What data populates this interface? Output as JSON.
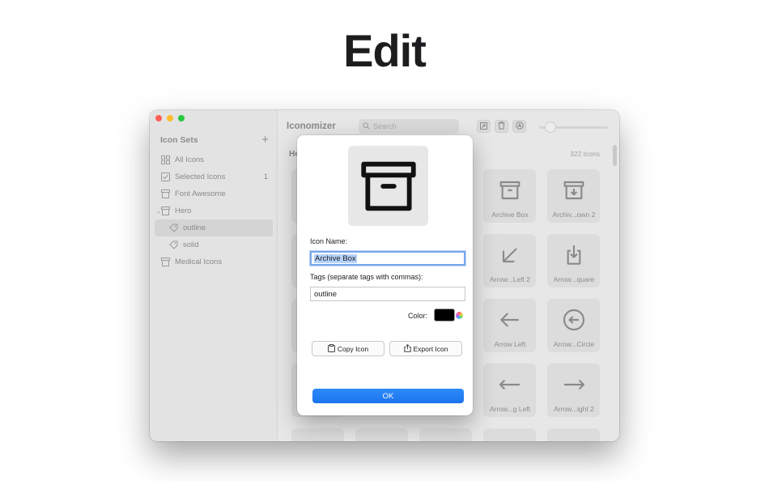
{
  "headline": "Edit",
  "window": {
    "sidebar": {
      "header": "Icon Sets",
      "add_symbol": "+",
      "items": [
        {
          "label": "All Icons",
          "icon": "grid-icon",
          "count": ""
        },
        {
          "label": "Selected Icons",
          "icon": "checkbox-icon",
          "count": "1"
        },
        {
          "label": "Font Awesome",
          "icon": "archive-icon",
          "count": ""
        },
        {
          "label": "Hero",
          "icon": "archive-icon",
          "count": "",
          "expanded": true
        },
        {
          "label": "outline",
          "icon": "tag-icon",
          "count": "",
          "selected": true
        },
        {
          "label": "solid",
          "icon": "tag-icon",
          "count": ""
        },
        {
          "label": "Medical Icons",
          "icon": "archive-icon",
          "count": ""
        }
      ]
    },
    "toolbar": {
      "title": "Iconomizer",
      "search_placeholder": "Search",
      "buttons": [
        "export-icon",
        "trash-icon",
        "app-store-icon"
      ]
    },
    "grid": {
      "section": "He",
      "count": "322 Icons",
      "tiles": [
        {
          "label": "Archive Box",
          "icon": "archive-box-icon"
        },
        {
          "label": "Archiv...own 2",
          "icon": "archive-box-arrow-down-icon"
        },
        {
          "label": "Arrow...Left 2",
          "icon": "arrow-down-left-icon"
        },
        {
          "label": "Arrow...quare",
          "icon": "arrow-down-on-square-icon"
        },
        {
          "label": "Arrow Left",
          "icon": "arrow-left-icon"
        },
        {
          "label": "Arrow...Circle",
          "icon": "arrow-left-circle-icon"
        },
        {
          "label": "Arrow...g Left",
          "icon": "arrow-long-left-icon"
        },
        {
          "label": "Arrow...ight 2",
          "icon": "arrow-long-right-icon"
        }
      ]
    }
  },
  "dialog": {
    "icon_name_label": "Icon Name:",
    "icon_name_value": "Archive Box",
    "tags_label": "Tags (separate tags with commas):",
    "tags_value": "outline",
    "color_label": "Color:",
    "color_value": "#000000",
    "copy_button": "Copy Icon",
    "export_button": "Export Icon",
    "ok_button": "OK"
  }
}
